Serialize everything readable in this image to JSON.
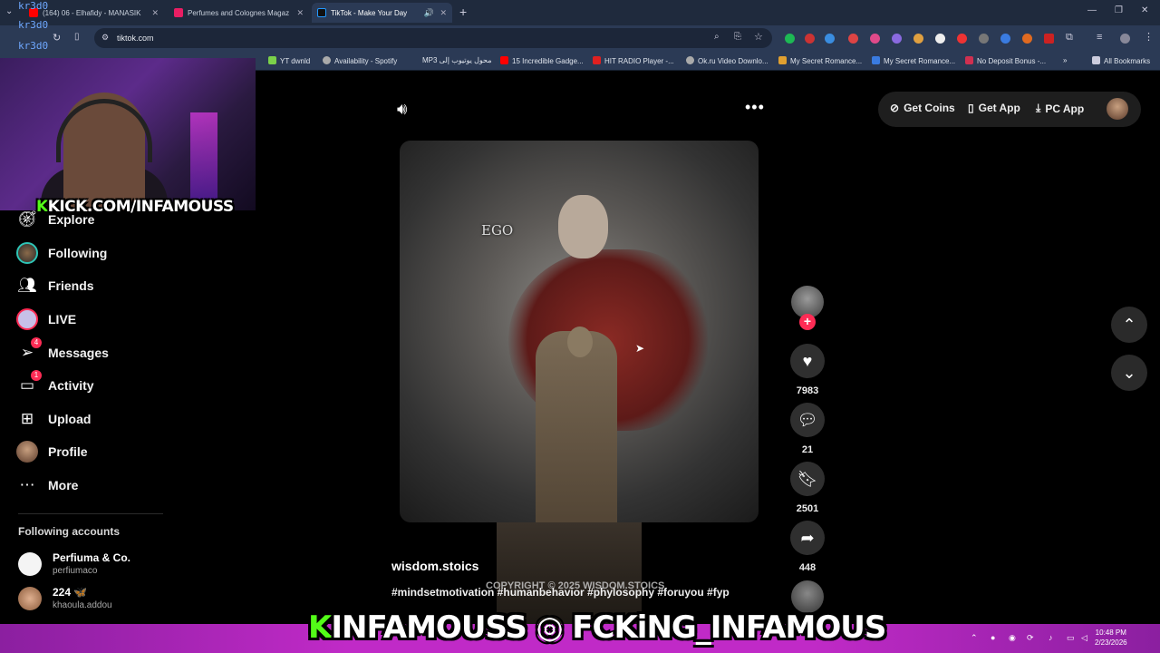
{
  "browser": {
    "tabs": [
      {
        "label": "(164) 06 - Elhafidy - MANASIK",
        "favicon_color": "#ff0000"
      },
      {
        "label": "Perfumes and Colognes Magaz",
        "favicon_color": "#e91e63"
      },
      {
        "label": "TikTok - Make Your Day",
        "favicon_color": "#111111"
      }
    ],
    "url": "tiktok.com",
    "bookmarks": [
      "YT  dwnld",
      "Availability - Spotify",
      "MP3 محول يوتيوب إلى",
      "15 Incredible Gadge...",
      "HIT RADIO Player -...",
      "Ok.ru Video Downlo...",
      "My Secret Romance...",
      "My Secret Romance...",
      "No Deposit Bonus -..."
    ],
    "all_bookmarks": "All Bookmarks"
  },
  "overlay": {
    "kr3d0_lines": [
      "kr3d0",
      "kr3d0",
      "kr3d0"
    ],
    "kick_k": "K",
    "kick_text": "KICK.COM/INFAMOUSS",
    "bottom_k": "K",
    "bottom_text": "INFAMOUSS",
    "bottom_handle": "FCKiNG_INFAMOUS"
  },
  "sidebar": {
    "items": [
      {
        "label": "Explore",
        "icon": "compass-icon"
      },
      {
        "label": "Following",
        "icon": "following-avatar-icon"
      },
      {
        "label": "Friends",
        "icon": "friends-icon"
      },
      {
        "label": "LIVE",
        "icon": "live-icon"
      },
      {
        "label": "Messages",
        "icon": "messages-icon",
        "badge": "4"
      },
      {
        "label": "Activity",
        "icon": "activity-icon",
        "badge": "1"
      },
      {
        "label": "Upload",
        "icon": "upload-icon"
      },
      {
        "label": "Profile",
        "icon": "profile-avatar-icon"
      },
      {
        "label": "More",
        "icon": "more-icon"
      }
    ],
    "following_title": "Following accounts",
    "accounts": [
      {
        "name": "Perfiuma & Co.",
        "handle": "perfiumaco"
      },
      {
        "name": "224 🦋",
        "handle": "khaoula.addou"
      }
    ]
  },
  "header": {
    "get_coins": "Get Coins",
    "get_app": "Get App",
    "pc_app": "PC App"
  },
  "video": {
    "overlay_word": "EGO",
    "copyright": "COPYRIGHT © 2025 WISDOM.STOICS",
    "username": "wisdom.stoics",
    "hashtags": "#mindsetmotivation #humanbehavior #phylosophy #foruyou #fyp"
  },
  "actions": {
    "likes": "7983",
    "comments": "21",
    "saves": "2501",
    "shares": "448"
  },
  "taskbar": {
    "time": "10:48 PM",
    "date": "2/23/2026"
  },
  "colors": {
    "accent": "#fe2c55",
    "kick_green": "#53fc18",
    "stream_band": "#c02ac7"
  }
}
